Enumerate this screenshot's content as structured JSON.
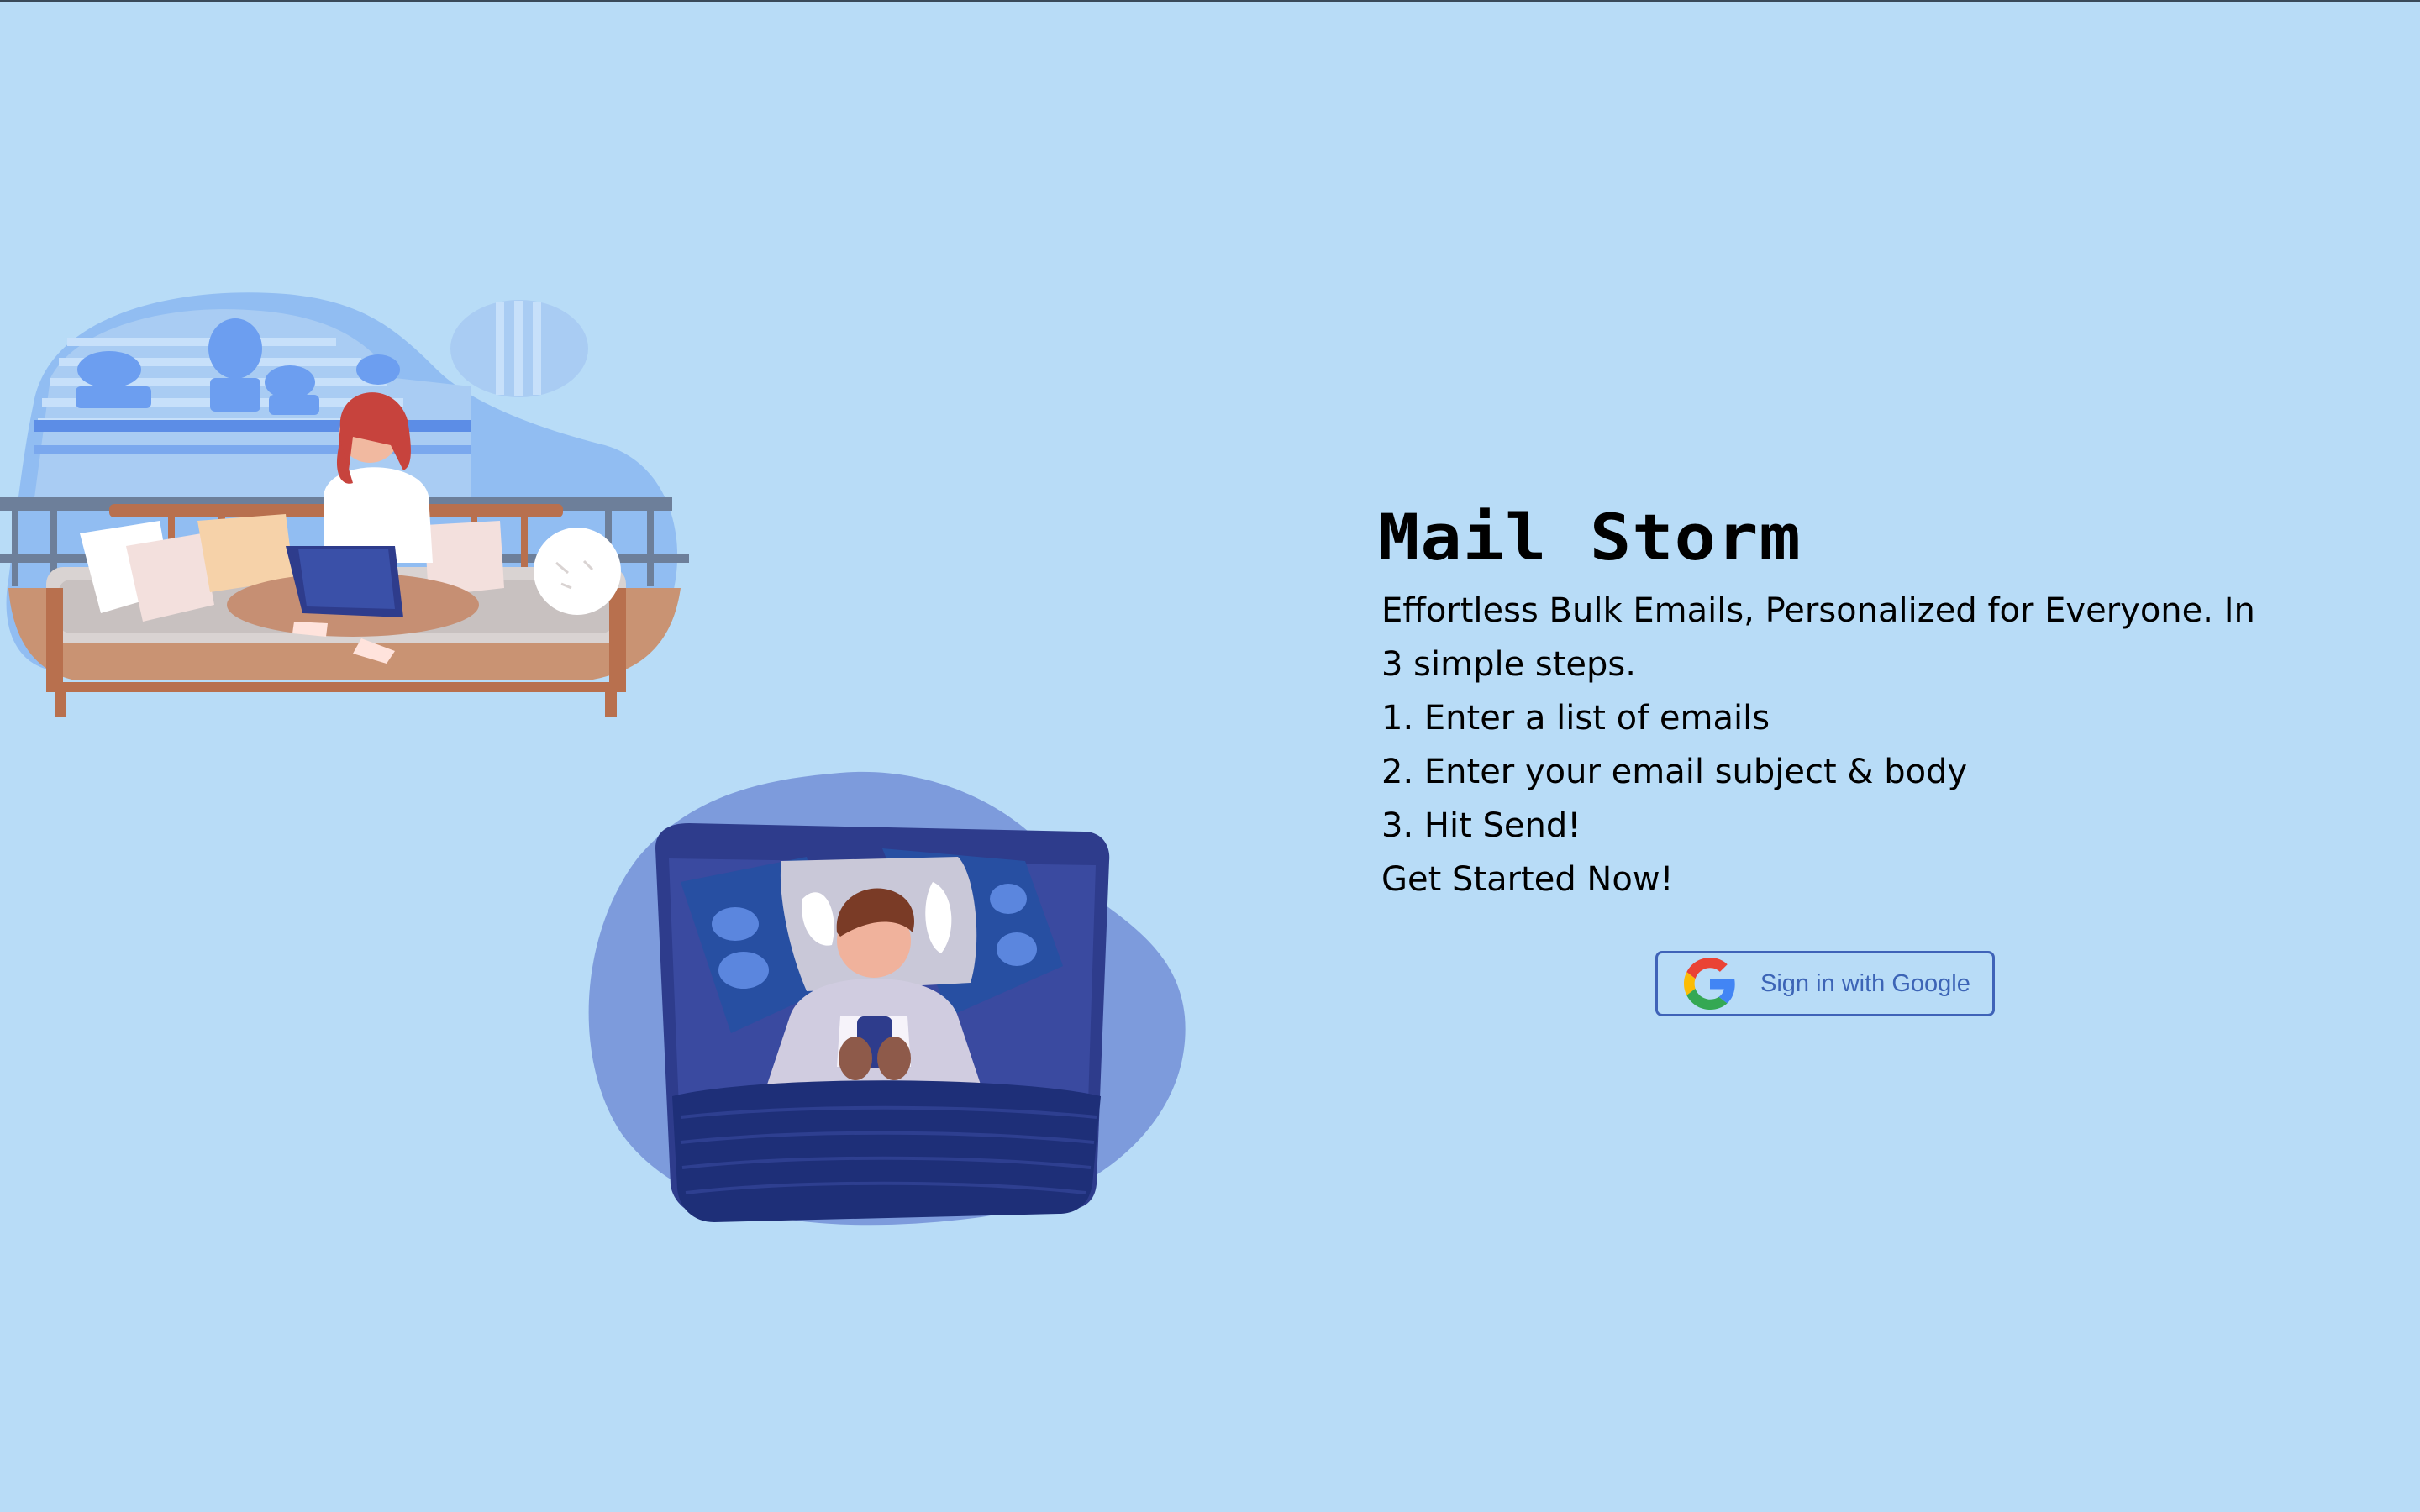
{
  "app": {
    "title": "Mail Storm"
  },
  "hero": {
    "tagline": "Effortless Bulk Emails, Personalized for Everyone. In 3 simple steps.",
    "steps": [
      "1. Enter a list of emails",
      "2. Enter your email subject & body",
      "3. Hit Send!"
    ],
    "cta_text": "Get Started Now!"
  },
  "auth": {
    "google_button_label": "Sign in with Google",
    "icon": "google-g-icon"
  },
  "illustrations": [
    {
      "name": "woman-on-sofa-with-laptop-illustration"
    },
    {
      "name": "man-in-bed-with-phone-illustration"
    }
  ],
  "colors": {
    "background": "#b8dcf7",
    "button_border": "#3f63b8",
    "button_text": "#3c64b6"
  }
}
